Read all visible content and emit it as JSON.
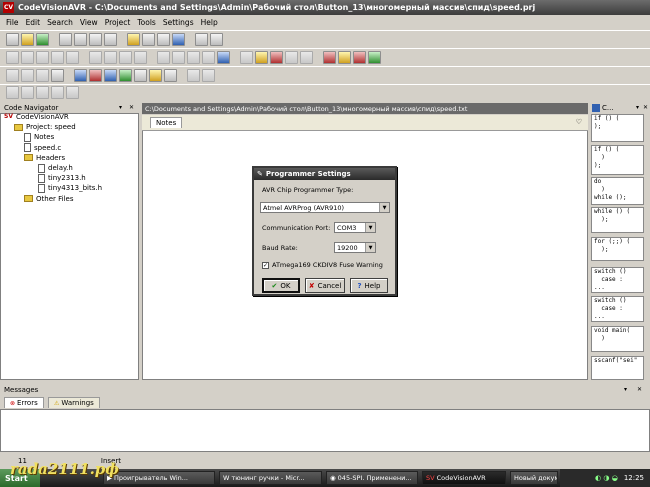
{
  "window": {
    "title": "CodeVisionAVR - C:\\Documents and Settings\\Admin\\Рабочий стол\\Button_13\\многомерный массив\\спид\\speed.prj"
  },
  "menu": [
    "File",
    "Edit",
    "Search",
    "View",
    "Project",
    "Tools",
    "Settings",
    "Help"
  ],
  "navigator": {
    "title": "Code Navigator",
    "items": [
      {
        "label": "CodeVisionAVR",
        "kind": "root"
      },
      {
        "label": "Project: speed",
        "kind": "folder"
      },
      {
        "label": "Notes",
        "kind": "doc"
      },
      {
        "label": "speed.c",
        "kind": "doc"
      },
      {
        "label": "Headers",
        "kind": "folder"
      },
      {
        "label": "delay.h",
        "kind": "doc"
      },
      {
        "label": "tiny2313.h",
        "kind": "doc"
      },
      {
        "label": "tiny4313_bits.h",
        "kind": "doc"
      },
      {
        "label": "Other Files",
        "kind": "folder"
      }
    ]
  },
  "editor": {
    "path": "C:\\Documents and Settings\\Admin\\Рабочий стол\\Button_13\\многомерный массив\\спид\\speed.txt",
    "tab": "Notes"
  },
  "dialog": {
    "title": "Programmer Settings",
    "type_label": "AVR Chip Programmer Type:",
    "type_value": "Atmel AVRProg (AVR910)",
    "port_label": "Communication Port:",
    "port_value": "COM3",
    "baud_label": "Baud Rate:",
    "baud_value": "19200",
    "fuse_label": "ATmega169 CKDIV8 Fuse Warning",
    "ok": "OK",
    "cancel": "Cancel",
    "help": "Help"
  },
  "codepanel": {
    "title": "C...",
    "snippets": [
      "if () (\n);",
      "if () (\n  )\n);\n...",
      "do\n  )\nwhile ();",
      "while () (\n  );",
      "for (;;) (\n  );",
      "switch ()\n  case :\n...",
      "switch ()\n  case :\n...",
      "void main(\n  )",
      "sscanf(\"sei\""
    ]
  },
  "messages": {
    "title": "Messages",
    "tabs": [
      "Errors",
      "Warnings"
    ]
  },
  "status": {
    "line": "11",
    "mode": "Insert"
  },
  "taskbar": {
    "start": "Start",
    "tasks": [
      "Проигрыватель Win...",
      "тюнинг ручки - Micr...",
      "045-SPI. Применени...",
      "CodeVisionAVR",
      "Новый документ - ..."
    ],
    "clock": "12:25"
  },
  "watermark": "rada2111.рф"
}
